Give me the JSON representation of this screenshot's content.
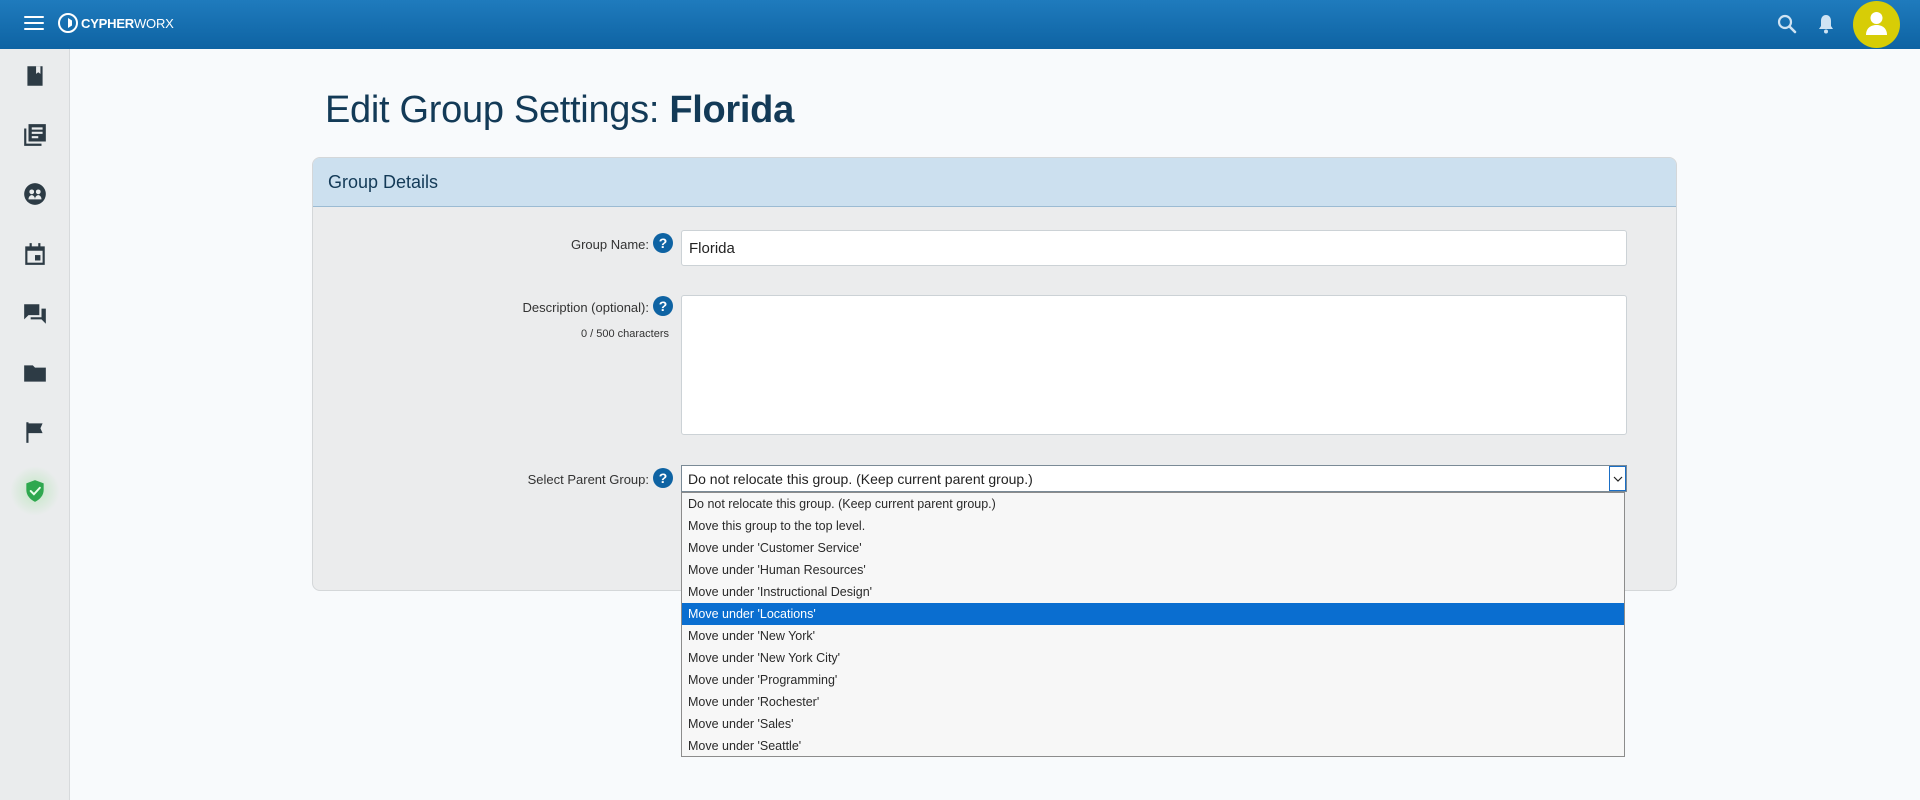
{
  "app": {
    "logo_text_bold": "CYPHER",
    "logo_text_light": "WORX"
  },
  "colors": {
    "topbar": "#0e63a3",
    "avatar": "#d7cd06",
    "accent": "#0e63a3",
    "selected_option": "#0a6ed0",
    "title": "#133a57"
  },
  "topbar": {
    "icons": [
      "menu-icon",
      "search-icon",
      "bell-icon",
      "user-avatar-icon"
    ]
  },
  "sidebar": {
    "items": [
      {
        "name": "book-icon"
      },
      {
        "name": "library-icon"
      },
      {
        "name": "groups-icon"
      },
      {
        "name": "calendar-icon"
      },
      {
        "name": "forum-icon"
      },
      {
        "name": "folder-icon"
      },
      {
        "name": "flag-icon"
      },
      {
        "name": "shield-check-icon",
        "active": true
      }
    ]
  },
  "page": {
    "title_prefix": "Edit Group Settings: ",
    "title_group": "Florida"
  },
  "card": {
    "header": "Group Details"
  },
  "form": {
    "group_name": {
      "label": "Group Name:",
      "value": "Florida",
      "help": "?"
    },
    "description": {
      "label": "Description (optional):",
      "value": "",
      "help": "?",
      "counter": "0 / 500 characters"
    },
    "parent_group": {
      "label": "Select Parent Group:",
      "help": "?",
      "selected": "Do not relocate this group. (Keep current parent group.)",
      "highlighted_index": 5,
      "options": [
        "Do not relocate this group. (Keep current parent group.)",
        "Move this group to the top level.",
        "Move under 'Customer Service'",
        "Move under 'Human Resources'",
        "Move under 'Instructional Design'",
        "Move under 'Locations'",
        "Move under 'New York'",
        "Move under 'New York City'",
        "Move under 'Programming'",
        "Move under 'Rochester'",
        "Move under 'Sales'",
        "Move under 'Seattle'"
      ]
    }
  }
}
